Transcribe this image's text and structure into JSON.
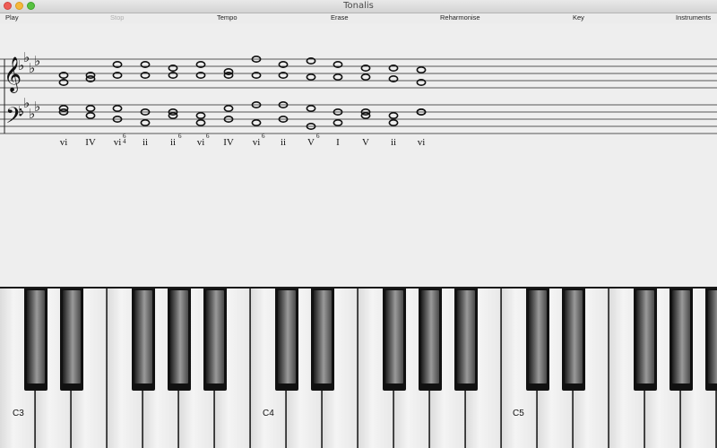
{
  "window": {
    "title": "Tonalis"
  },
  "menu": [
    {
      "label": "Play",
      "enabled": true
    },
    {
      "label": "Stop",
      "enabled": false
    },
    {
      "label": "Tempo",
      "enabled": true
    },
    {
      "label": "Erase",
      "enabled": true
    },
    {
      "label": "Reharmonise",
      "enabled": true
    },
    {
      "label": "Key",
      "enabled": true
    },
    {
      "label": "Instruments",
      "enabled": true
    }
  ],
  "score": {
    "key_signature": "A-flat major / F minor (4 flats)",
    "chords": [
      {
        "numeral": "vi",
        "sup": ""
      },
      {
        "numeral": "IV",
        "sup": ""
      },
      {
        "numeral": "vi",
        "sup": "6/4"
      },
      {
        "numeral": "ii",
        "sup": ""
      },
      {
        "numeral": "ii",
        "sup": "6"
      },
      {
        "numeral": "vi",
        "sup": "6"
      },
      {
        "numeral": "IV",
        "sup": ""
      },
      {
        "numeral": "vi",
        "sup": "6"
      },
      {
        "numeral": "ii",
        "sup": ""
      },
      {
        "numeral": "V",
        "sup": "6"
      },
      {
        "numeral": "I",
        "sup": ""
      },
      {
        "numeral": "V",
        "sup": ""
      },
      {
        "numeral": "ii",
        "sup": ""
      },
      {
        "numeral": "vi",
        "sup": ""
      }
    ]
  },
  "keyboard": {
    "labels": [
      "C3",
      "C4",
      "C5"
    ]
  },
  "colors": {
    "close_light": "#ee5c55",
    "minimize_light": "#f5b83a",
    "zoom_light": "#58c241"
  }
}
